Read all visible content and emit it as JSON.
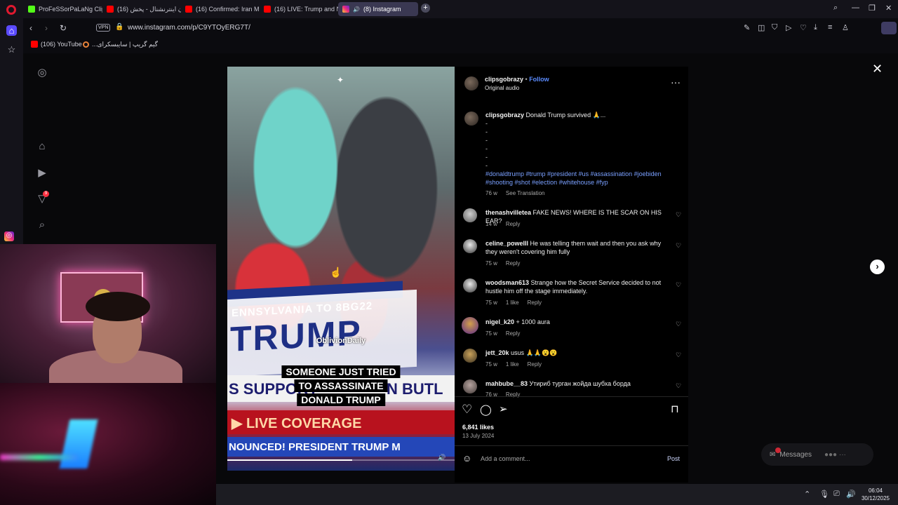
{
  "browser": {
    "tabs": [
      {
        "label": "ProFeSSorPaLaNg Clips - ",
        "favicon": "kick"
      },
      {
        "label": "ایران اینترنشنال - پخش (16)",
        "favicon": "youtube"
      },
      {
        "label": "(16) Confirmed: Iran Missi",
        "favicon": "youtube"
      },
      {
        "label": "(16) LIVE: Trump and Neta",
        "favicon": "youtube"
      },
      {
        "label": "(8) Instagram",
        "favicon": "instagram",
        "active": true
      }
    ],
    "url": "www.instagram.com/p/C9YTOyERG7T/",
    "vpn_label": "VPN",
    "ai_label": "AI",
    "bookmarks": [
      {
        "label": "(106) YouTube"
      },
      {
        "label": "...گیم گریپ | سایبسکرای"
      }
    ]
  },
  "post": {
    "author": "clipsgobrazy",
    "follow_label": "Follow",
    "audio": "Original audio",
    "caption_user": "clipsgobrazy",
    "caption_text": "Donald Trump survived 🙏...",
    "caption_dashes": [
      "-",
      "-",
      "-",
      "-",
      "-",
      "-"
    ],
    "hashtags_line1": "#donaldtrump #trump #president #us #assassination #joebiden",
    "hashtags_line2": "#shooting #shot #election #whitehouse #fyp",
    "caption_age": "76 w",
    "see_translation": "See Translation",
    "likes": "6,841 likes",
    "date": "13 July 2024",
    "add_comment_placeholder": "Add a comment...",
    "post_label": "Post",
    "video": {
      "watermark": "OblivionDaily",
      "caption_lines": [
        "SOMEONE JUST TRIED",
        "TO ASSASSINATE",
        "DONALD TRUMP"
      ],
      "sign_state": "ENNSYLVANIA TO 8BG22",
      "sign_trump": "TRUMP",
      "ticker_support": "S SUPPORT",
      "ticker_butl": "N BUTL",
      "live_coverage": "LIVE COVERAGE",
      "announced": "NOUNCED!   PRESIDENT TRUMP M",
      "progress": 0.55
    }
  },
  "comments": [
    {
      "user": "thenashvilletea",
      "text": "FAKE NEWS! WHERE IS THE SCAR ON HIS EAR?",
      "age": "14 w",
      "likes": "",
      "reply": "Reply"
    },
    {
      "user": "celine_powelll",
      "text": "He was telling them wait and then you ask why they weren't covering him fully",
      "age": "75 w",
      "likes": "",
      "reply": "Reply"
    },
    {
      "user": "woodsman613",
      "text": "Strange how the Secret Service decided to not hustle him off the stage immediately.",
      "age": "75 w",
      "likes": "1 like",
      "reply": "Reply"
    },
    {
      "user": "nigel_k20",
      "text": "+ 1000 aura",
      "age": "75 w",
      "likes": "",
      "reply": "Reply"
    },
    {
      "user": "jett_20k",
      "text": "usus 🙏🙏😮😮",
      "age": "75 w",
      "likes": "1 like",
      "reply": "Reply"
    },
    {
      "user": "mahbube__83",
      "text": "Утириб турган жойда шубха борда",
      "age": "76 w",
      "likes": "",
      "reply": "Reply"
    }
  ],
  "messages": {
    "label": "Messages"
  },
  "ig_notification_count": "9",
  "taskbar": {
    "time": "06:04",
    "date": "30/12/2025"
  },
  "colors": {
    "accent_link": "#5b8cff",
    "hashtag": "#7aa0ff",
    "opera_red": "#e0192f",
    "badge_red": "#ff3040"
  }
}
